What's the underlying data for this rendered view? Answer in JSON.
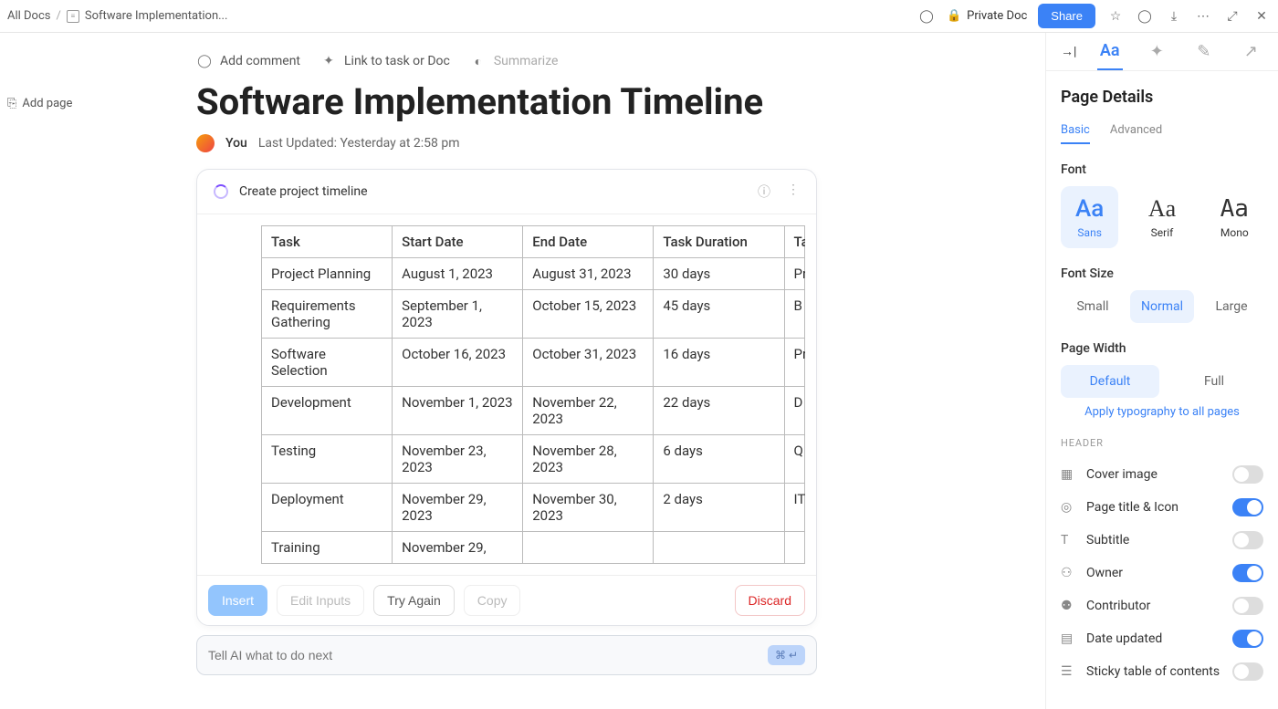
{
  "breadcrumb": {
    "root": "All Docs",
    "current": "Software Implementation..."
  },
  "topbar": {
    "private": "Private Doc",
    "share": "Share"
  },
  "leftGutter": {
    "addPage": "Add page"
  },
  "docActions": {
    "comment": "Add comment",
    "link": "Link to task or Doc",
    "summarize": "Summarize"
  },
  "doc": {
    "title": "Software Implementation Timeline",
    "author": "You",
    "updated": "Last Updated: Yesterday at 2:58 pm"
  },
  "ai": {
    "headerTitle": "Create project timeline",
    "table": {
      "columns": [
        "Task",
        "Start Date",
        "End Date",
        "Task Duration",
        "Ta"
      ],
      "rows": [
        [
          "Project Planning",
          "August 1, 2023",
          "August 31, 2023",
          "30 days",
          "Pr"
        ],
        [
          "Requirements Gathering",
          "September 1, 2023",
          "October 15, 2023",
          "45 days",
          "B"
        ],
        [
          "Software Selection",
          "October 16, 2023",
          "October 31, 2023",
          "16 days",
          "Pr"
        ],
        [
          "Development",
          "November 1, 2023",
          "November 22, 2023",
          "22 days",
          "D"
        ],
        [
          "Testing",
          "November 23, 2023",
          "November 28, 2023",
          "6 days",
          "Q"
        ],
        [
          "Deployment",
          "November 29, 2023",
          "November 30, 2023",
          "2 days",
          "IT"
        ],
        [
          "Training",
          "November 29,",
          "",
          "",
          ""
        ]
      ]
    },
    "buttons": {
      "insert": "Insert",
      "edit": "Edit Inputs",
      "tryAgain": "Try Again",
      "copy": "Copy",
      "discard": "Discard"
    },
    "promptPlaceholder": "Tell AI what to do next",
    "kbd": "⌘ ↵"
  },
  "sidebar": {
    "title": "Page Details",
    "subtabs": {
      "basic": "Basic",
      "advanced": "Advanced"
    },
    "font": {
      "label": "Font",
      "sans": "Sans",
      "serif": "Serif",
      "mono": "Mono"
    },
    "fontSize": {
      "label": "Font Size",
      "small": "Small",
      "normal": "Normal",
      "large": "Large"
    },
    "pageWidth": {
      "label": "Page Width",
      "default": "Default",
      "full": "Full"
    },
    "applyAll": "Apply typography to all pages",
    "headerCap": "HEADER",
    "toggles": {
      "cover": "Cover image",
      "titleIcon": "Page title & Icon",
      "subtitle": "Subtitle",
      "owner": "Owner",
      "contributor": "Contributor",
      "dateUpdated": "Date updated",
      "stickyToc": "Sticky table of contents"
    }
  }
}
